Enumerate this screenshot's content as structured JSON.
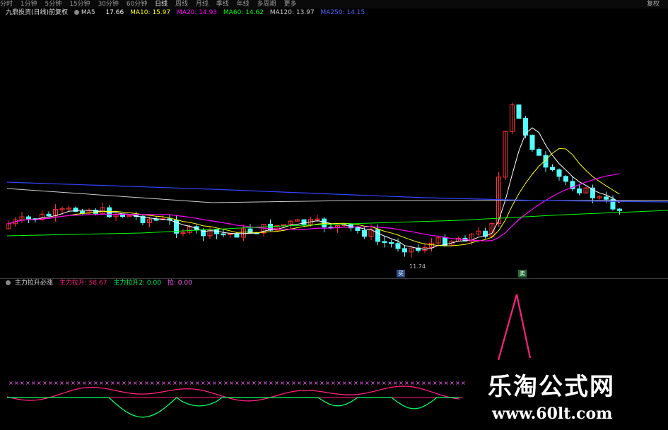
{
  "toolbar": {
    "items": [
      "分时",
      "1分钟",
      "5分钟",
      "15分钟",
      "30分钟",
      "60分钟",
      "日线",
      "周线",
      "月线",
      "季线",
      "年线",
      "多周期",
      "更多"
    ],
    "active_index": 6,
    "right_label": "复权"
  },
  "main_legend": {
    "title": "九鼎投资(日线)前复权",
    "ma_label": "MA5",
    "ma5": "17.66",
    "ma10": "MA10: 15.97",
    "ma20": "MA20: 14.93",
    "ma60": "MA60: 14.62",
    "ma120": "MA120: 13.97",
    "ma250": "MA250: 14.15",
    "colors": {
      "ma5": "#ffffff",
      "ma10": "#ffff00",
      "ma20": "#ff00ff",
      "ma60": "#00ff00",
      "ma120": "#cccccc",
      "ma250": "#3344ff"
    }
  },
  "sub_legend": {
    "title": "主力拉升必涨",
    "line1": "主力拉升: 58.67",
    "line2": "主力拉升2: 0.00",
    "line3": "拉: 0.00",
    "colors": {
      "line1": "#ff2080",
      "line2": "#00ff66",
      "line3": "#ff66ff"
    }
  },
  "chart_marks": {
    "low_label": "11.74",
    "buy_tag": "买",
    "sell_tag": "卖"
  },
  "watermark": {
    "title": "乐淘公式网",
    "url": "www.60lt.com"
  }
}
